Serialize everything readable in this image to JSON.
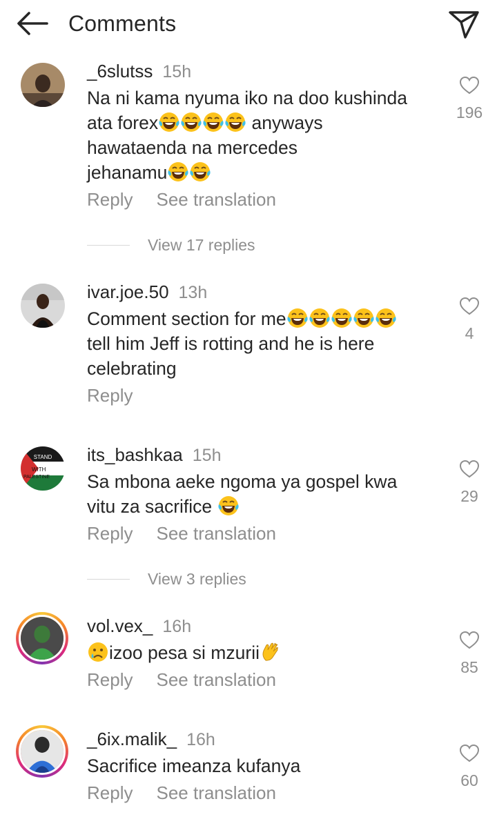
{
  "header": {
    "title": "Comments"
  },
  "actions": {
    "reply": "Reply",
    "see_translation": "See translation"
  },
  "comments": [
    {
      "username": "_6slutss",
      "time": "15h",
      "text_parts": [
        "Na ni kama nyuma iko na doo kushinda",
        "ata forex",
        "anyways",
        "hawataenda na mercedes",
        "jehanamu"
      ],
      "likes": "196",
      "view_replies": "View 17 replies"
    },
    {
      "username": "ivar.joe.50",
      "time": "13h",
      "text_parts": [
        "Comment section for me",
        "tell him Jeff is rotting and he is here",
        "celebrating"
      ],
      "likes": "4"
    },
    {
      "username": "its_bashkaa",
      "time": "15h",
      "text_parts": [
        "Sa mbona aeke ngoma ya gospel kwa",
        "vitu za sacrifice"
      ],
      "likes": "29",
      "view_replies": "View 3 replies",
      "avatar_text": [
        "STAND",
        "WITH",
        "PALESTINE"
      ]
    },
    {
      "username": "vol.vex_",
      "time": "16h",
      "text_parts": [
        "izoo pesa si mzurii"
      ],
      "likes": "85"
    },
    {
      "username": "_6ix.malik_",
      "time": "16h",
      "text_parts": [
        "Sacrifice imeanza kufanya"
      ],
      "likes": "60"
    }
  ],
  "colors": {
    "text": "#262626",
    "muted": "#8e8e8e",
    "divider": "#d8d8d8",
    "emoji_face": "#fcc21b",
    "tear": "#40c0e7"
  },
  "icons": {
    "back": "arrow-left-icon",
    "share": "paper-plane-icon",
    "like": "heart-outline-icon",
    "laugh": "tears-of-joy-emoji",
    "sad": "sad-tear-emoji",
    "clap": "clapping-hands-emoji"
  }
}
